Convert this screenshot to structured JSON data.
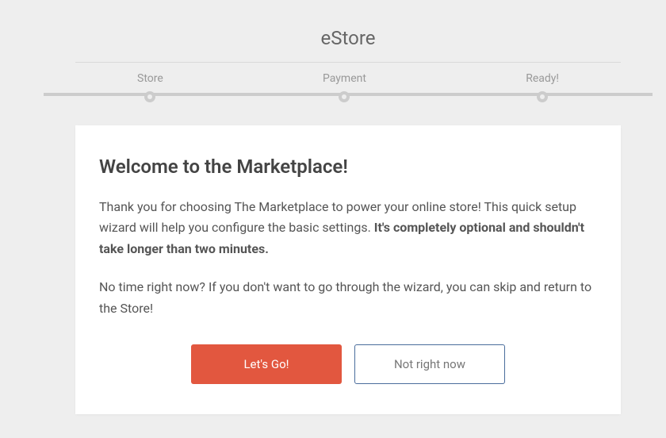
{
  "header": {
    "title": "eStore"
  },
  "stepper": {
    "steps": [
      {
        "label": "Store"
      },
      {
        "label": "Payment"
      },
      {
        "label": "Ready!"
      }
    ]
  },
  "card": {
    "title": "Welcome to the Marketplace!",
    "intro_prefix": "Thank you for choosing The Marketplace to power your online store! This quick setup wizard will help you configure the basic settings. ",
    "intro_bold": "It's completely optional and shouldn't take longer than two minutes.",
    "skip_text": "No time right now? If you don't want to go through the wizard, you can skip and return to the Store!",
    "buttons": {
      "primary": "Let's Go!",
      "secondary": "Not right now"
    }
  }
}
